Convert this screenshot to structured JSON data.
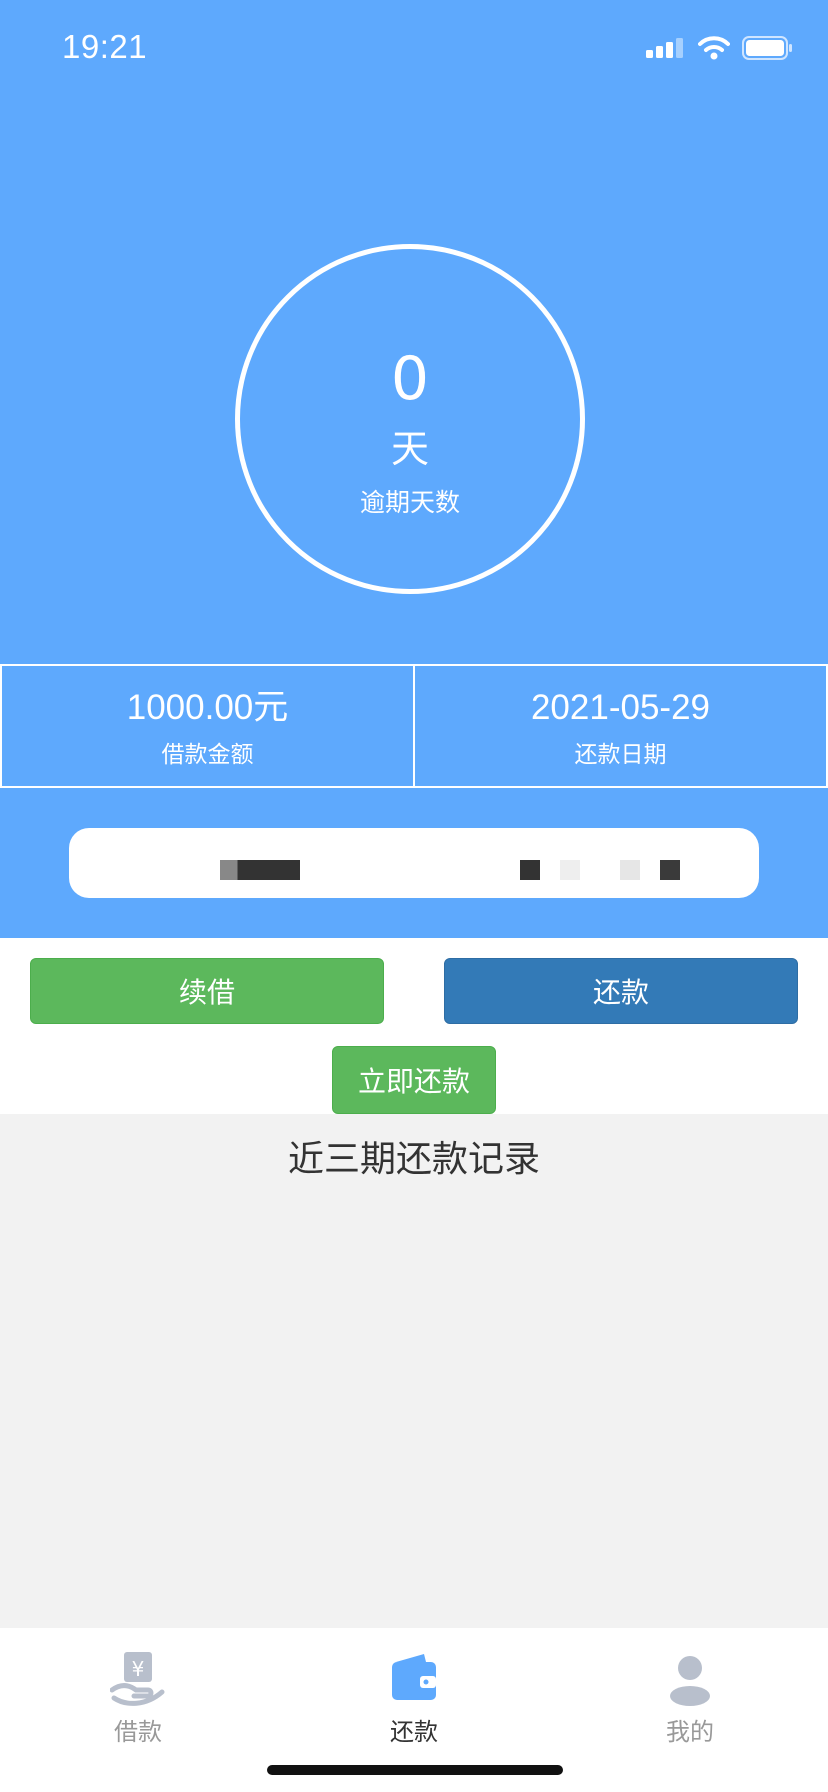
{
  "status_bar": {
    "time": "19:21"
  },
  "overdue": {
    "days": "0",
    "unit": "天",
    "caption": "逾期天数"
  },
  "stats": {
    "loan_amount": {
      "value": "1000.00元",
      "label": "借款金额"
    },
    "repay_date": {
      "value": "2021-05-29",
      "label": "还款日期"
    }
  },
  "actions": {
    "renew_label": "续借",
    "repay_label": "还款",
    "repay_now_label": "立即还款"
  },
  "records": {
    "title": "近三期还款记录"
  },
  "tabbar": {
    "items": [
      {
        "label": "借款",
        "icon": "hand-yen-icon",
        "active": false
      },
      {
        "label": "还款",
        "icon": "wallet-icon",
        "active": true
      },
      {
        "label": "我的",
        "icon": "user-icon",
        "active": false
      }
    ]
  },
  "colors": {
    "primary_blue": "#5ea9fd",
    "green": "#5cb85c",
    "dark_blue": "#337ab7",
    "tab_active": "#5ea9fd",
    "tab_inactive": "#b8bfcc"
  }
}
